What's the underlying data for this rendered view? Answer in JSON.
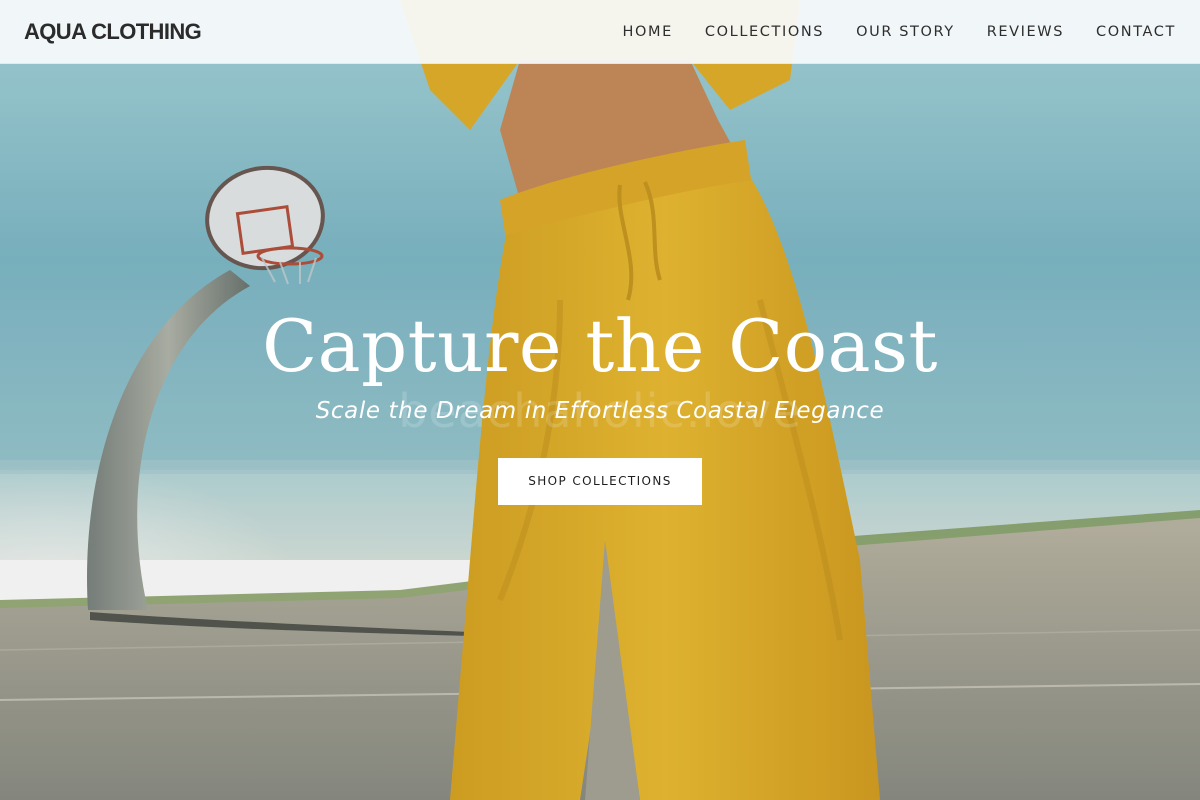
{
  "header": {
    "brand": "AQUA CLOTHING",
    "nav": [
      {
        "label": "HOME"
      },
      {
        "label": "COLLECTIONS"
      },
      {
        "label": "OUR STORY"
      },
      {
        "label": "REVIEWS"
      },
      {
        "label": "CONTACT"
      }
    ]
  },
  "hero": {
    "title": "Capture the Coast",
    "subtitle": "Scale the Dream in Effortless Coastal Elegance",
    "cta_label": "SHOP COLLECTIONS",
    "watermark": "beachaholic.love",
    "background_description_icon": "hero-photo"
  },
  "colors": {
    "sky": "#8cc6d2",
    "ocean": "#8ec2cc",
    "court": "#a3a297",
    "outfit": "#e6b62a",
    "header_bg": "#f8fbfc",
    "text_dark": "#2b2b2b",
    "button_bg": "#ffffff"
  }
}
